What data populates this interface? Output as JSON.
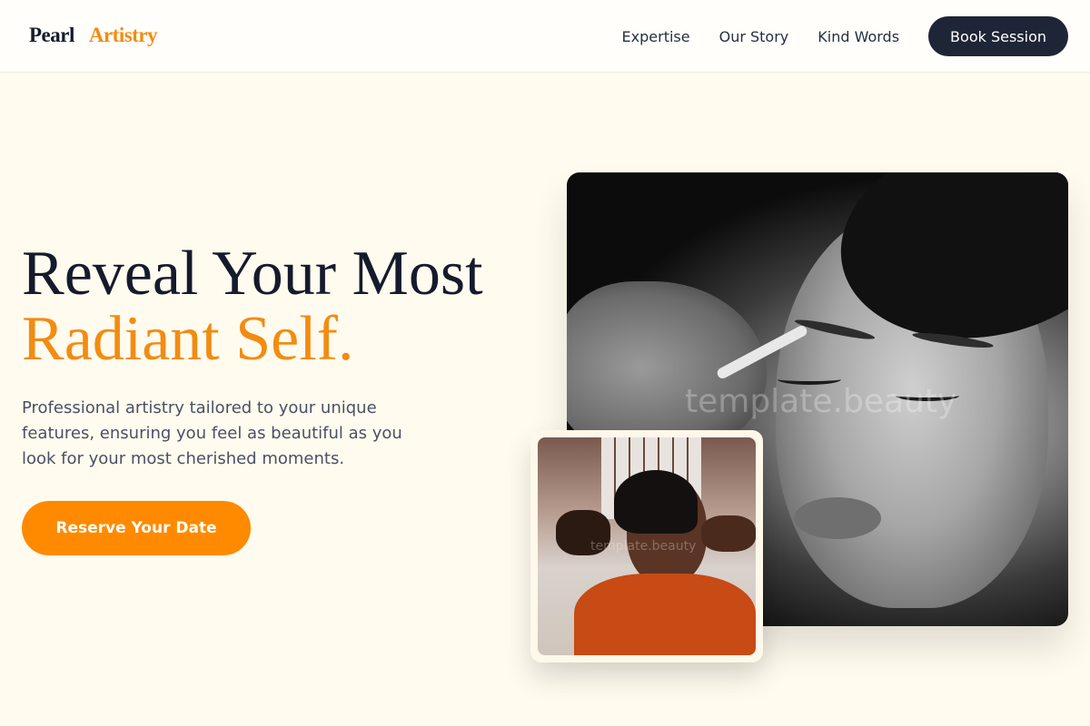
{
  "brand": {
    "part1": "Pearl",
    "part2": "Artistry"
  },
  "nav": {
    "items": [
      "Expertise",
      "Our Story",
      "Kind Words"
    ],
    "cta": "Book Session"
  },
  "hero": {
    "title_line1": "Reveal Your Most",
    "title_line2": "Radiant Self.",
    "description": "Professional artistry tailored to your unique features, ensuring you feel as beautiful as you look for your most cherished moments.",
    "cta": "Reserve Your Date"
  },
  "images": {
    "main_watermark": "template.beauty",
    "small_watermark": "template.beauty"
  },
  "colors": {
    "accent": "#f28c12",
    "button_orange": "#ff8a00",
    "navy": "#1e2537",
    "background": "#fffbef"
  }
}
